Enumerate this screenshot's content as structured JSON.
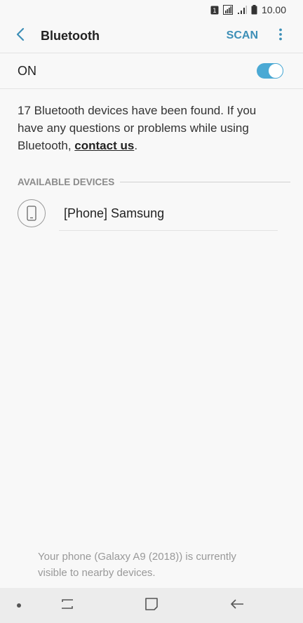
{
  "status_bar": {
    "sim_badge": "1",
    "time": "10.00"
  },
  "header": {
    "title": "Bluetooth",
    "scan_label": "SCAN"
  },
  "toggle_row": {
    "label": "ON",
    "enabled": true,
    "accent_color": "#4ba9d4"
  },
  "info": {
    "text": "17 Bluetooth devices have been found. If you have any questions or problems while using Bluetooth, ",
    "link": "contact us",
    "suffix": "."
  },
  "available_devices": {
    "header": "AVAILABLE DEVICES",
    "items": [
      {
        "name": "[Phone] Samsung",
        "icon": "smartphone-icon"
      }
    ]
  },
  "footer": {
    "visibility_text": "Your phone (Galaxy A9 (2018)) is currently visible to nearby devices."
  },
  "colors": {
    "accent": "#3d8fb7",
    "background": "#f8f8f8",
    "nav_background": "#ececec"
  }
}
